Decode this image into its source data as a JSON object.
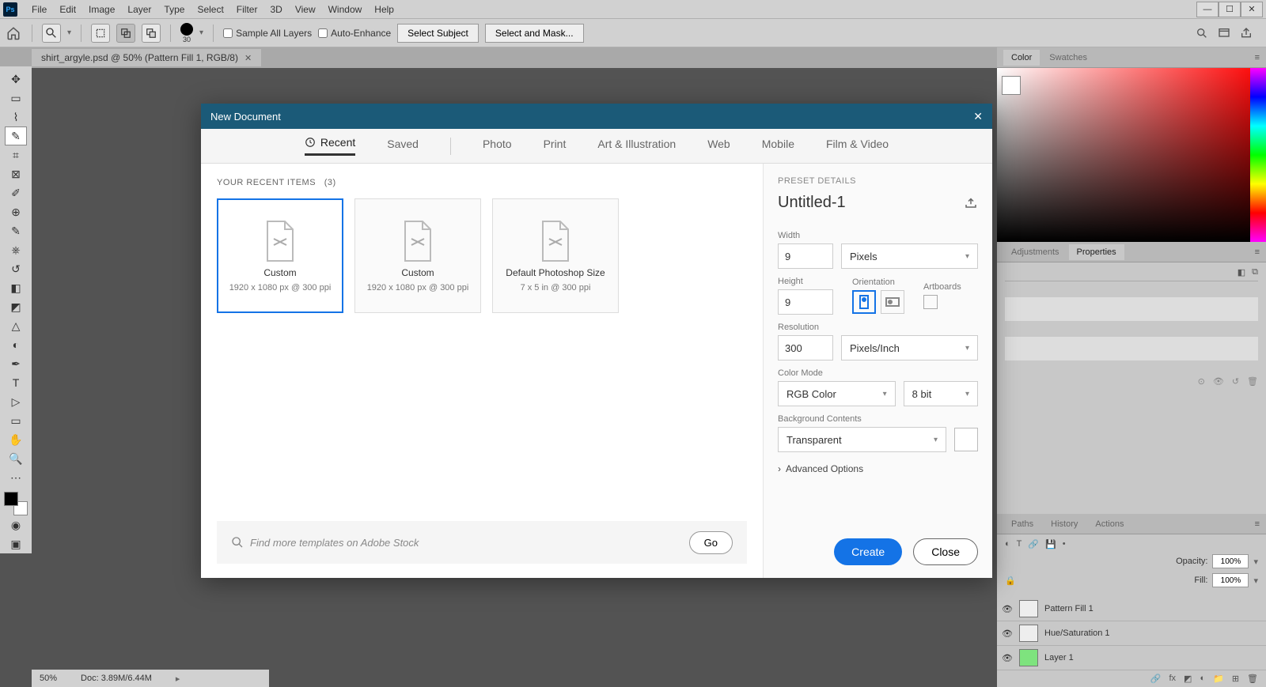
{
  "menu": {
    "items": [
      "File",
      "Edit",
      "Image",
      "Layer",
      "Type",
      "Select",
      "Filter",
      "3D",
      "View",
      "Window",
      "Help"
    ]
  },
  "options": {
    "brush_size": "30",
    "sample_all": "Sample All Layers",
    "auto_enhance": "Auto-Enhance",
    "select_subject": "Select Subject",
    "select_mask": "Select and Mask..."
  },
  "doc_tab": "shirt_argyle.psd @ 50% (Pattern Fill 1, RGB/8)",
  "panels": {
    "color": "Color",
    "swatches": "Swatches",
    "adjustments": "Adjustments",
    "properties": "Properties",
    "paths": "Paths",
    "history": "History",
    "actions": "Actions",
    "opacity_lbl": "Opacity:",
    "opacity_val": "100%",
    "fill_lbl": "Fill:",
    "fill_val": "100%",
    "layer1": "Pattern Fill 1",
    "layer2": "Hue/Saturation 1",
    "layer3": "Layer 1"
  },
  "status": {
    "zoom": "50%",
    "doc": "Doc: 3.89M/6.44M"
  },
  "dialog": {
    "title": "New Document",
    "tabs": {
      "recent": "Recent",
      "saved": "Saved",
      "photo": "Photo",
      "print": "Print",
      "art": "Art & Illustration",
      "web": "Web",
      "mobile": "Mobile",
      "film": "Film & Video"
    },
    "recent_hdr": "YOUR RECENT ITEMS",
    "recent_count": "(3)",
    "presets": [
      {
        "title": "Custom",
        "sub": "1920 x 1080 px @ 300 ppi"
      },
      {
        "title": "Custom",
        "sub": "1920 x 1080 px @ 300 ppi"
      },
      {
        "title": "Default Photoshop Size",
        "sub": "7 x 5 in @ 300 ppi"
      }
    ],
    "stock_placeholder": "Find more templates on Adobe Stock",
    "go": "Go",
    "details": {
      "hdr": "PRESET DETAILS",
      "name": "Untitled-1",
      "width_lbl": "Width",
      "width_val": "9",
      "width_unit": "Pixels",
      "height_lbl": "Height",
      "height_val": "9",
      "orient_lbl": "Orientation",
      "artboards_lbl": "Artboards",
      "res_lbl": "Resolution",
      "res_val": "300",
      "res_unit": "Pixels/Inch",
      "mode_lbl": "Color Mode",
      "mode_val": "RGB Color",
      "bit_val": "8 bit",
      "bg_lbl": "Background Contents",
      "bg_val": "Transparent",
      "adv": "Advanced Options"
    },
    "create": "Create",
    "close": "Close"
  }
}
